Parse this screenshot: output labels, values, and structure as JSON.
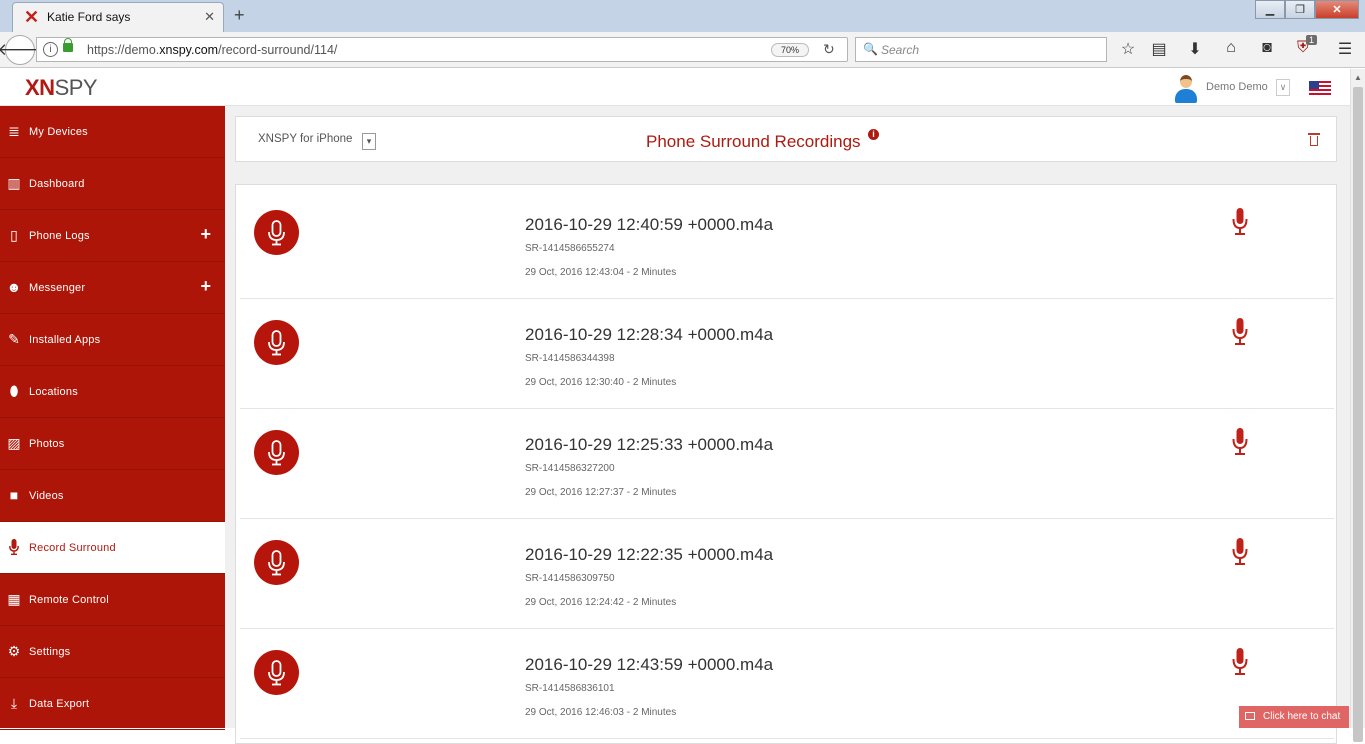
{
  "browser": {
    "tab_title": "Katie Ford says",
    "tab_close": "✕",
    "new_tab": "+",
    "url_prefix": "https://demo.",
    "url_domain": "xnspy.com",
    "url_path": "/record-surround/114/",
    "zoom": "70%",
    "search_placeholder": "Search",
    "ublock_badge": "1"
  },
  "header": {
    "logo_xn": "XN",
    "logo_spy": "SPY",
    "user_name": "Demo Demo"
  },
  "sidebar": {
    "items": [
      {
        "label": "My Devices",
        "icon": "≣"
      },
      {
        "label": "Dashboard",
        "icon": "▥"
      },
      {
        "label": "Phone Logs",
        "icon": "▯",
        "expand": "+"
      },
      {
        "label": "Messenger",
        "icon": "☻",
        "expand": "+"
      },
      {
        "label": "Installed Apps",
        "icon": "✎"
      },
      {
        "label": "Locations",
        "icon": "⬮"
      },
      {
        "label": "Photos",
        "icon": "▨"
      },
      {
        "label": "Videos",
        "icon": "■"
      },
      {
        "label": "Record Surround",
        "icon": "🎤"
      },
      {
        "label": "Remote Control",
        "icon": "▦"
      },
      {
        "label": "Settings",
        "icon": "⚙"
      },
      {
        "label": "Data Export",
        "icon": "⤓"
      }
    ]
  },
  "main": {
    "device_selector": "XNSPY for iPhone",
    "title": "Phone Surround Recordings",
    "info": "i",
    "recordings": [
      {
        "name": "2016-10-29 12:40:59 +0000.m4a",
        "id": "SR-1414586655274",
        "meta": "29 Oct, 2016 12:43:04 - 2 Minutes"
      },
      {
        "name": "2016-10-29 12:28:34 +0000.m4a",
        "id": "SR-1414586344398",
        "meta": "29 Oct, 2016 12:30:40 - 2 Minutes"
      },
      {
        "name": "2016-10-29 12:25:33 +0000.m4a",
        "id": "SR-1414586327200",
        "meta": "29 Oct, 2016 12:27:37 - 2 Minutes"
      },
      {
        "name": "2016-10-29 12:22:35 +0000.m4a",
        "id": "SR-1414586309750",
        "meta": "29 Oct, 2016 12:24:42 - 2 Minutes"
      },
      {
        "name": "2016-10-29 12:43:59 +0000.m4a",
        "id": "SR-1414586836101",
        "meta": "29 Oct, 2016 12:46:03 - 2 Minutes"
      }
    ]
  },
  "chat": {
    "label": "Click here to chat"
  },
  "colors": {
    "brand_red": "#ad1508",
    "accent": "#b5150a"
  }
}
